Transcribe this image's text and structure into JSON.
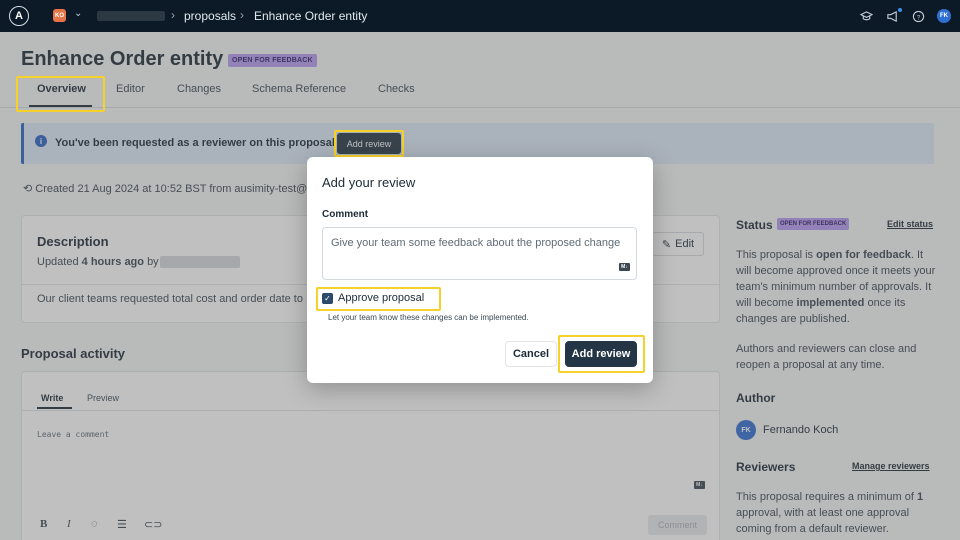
{
  "topnav": {
    "logo": "A",
    "org_badge": "KO",
    "breadcrumbs": [
      "proposals",
      "Enhance Order entity"
    ],
    "user_initials": "FK"
  },
  "page": {
    "title": "Enhance Order entity",
    "status_badge": "OPEN FOR FEEDBACK",
    "tabs": [
      "Overview",
      "Editor",
      "Changes",
      "Schema Reference",
      "Checks"
    ],
    "active_tab": "Overview"
  },
  "banner": {
    "text": "You've been requested as a reviewer on this proposal",
    "button": "Add review"
  },
  "created": "Created 21 Aug 2024 at 10:52 BST from ausimity-test@",
  "description": {
    "title": "Description",
    "updated_prefix": "Updated",
    "updated_time": "4 hours ago",
    "updated_by": "by",
    "edit_label": "Edit",
    "body": "Our client teams requested total cost and order date to"
  },
  "activity": {
    "title": "Proposal activity",
    "tabs": [
      "Write",
      "Preview"
    ],
    "placeholder": "Leave a comment",
    "comment_button": "Comment"
  },
  "sidebar": {
    "status_label": "Status",
    "status_badge": "OPEN FOR FEEDBACK",
    "edit_status": "Edit status",
    "status_text_1a": "This proposal is ",
    "status_text_1b": "open for feedback",
    "status_text_1c": ". It will become approved once it meets your team's minimum number of approvals. It will become ",
    "status_text_1d": "implemented",
    "status_text_1e": " once its changes are published.",
    "status_text_2": "Authors and reviewers can close and reopen a proposal at any time.",
    "author_label": "Author",
    "author_initials": "FK",
    "author_name": "Fernando Koch",
    "reviewers_label": "Reviewers",
    "manage_reviewers": "Manage reviewers",
    "reviewers_text_a": "This proposal requires a minimum of ",
    "reviewers_text_b": "1",
    "reviewers_text_c": " approval, with at least one approval coming from a default reviewer."
  },
  "modal": {
    "title": "Add your review",
    "comment_label": "Comment",
    "comment_placeholder": "Give your team some feedback about the proposed change",
    "markdown_badge": "M↓",
    "approve_label": "Approve proposal",
    "approve_checked": true,
    "help_text": "Let your team know these changes can be implemented.",
    "cancel": "Cancel",
    "submit": "Add review"
  },
  "colors": {
    "nav_bg": "#0b1a26",
    "badge_purple": "#b59bf2",
    "primary_button": "#243645",
    "highlight": "#f5d12a",
    "info_blue": "#2a64c4"
  }
}
